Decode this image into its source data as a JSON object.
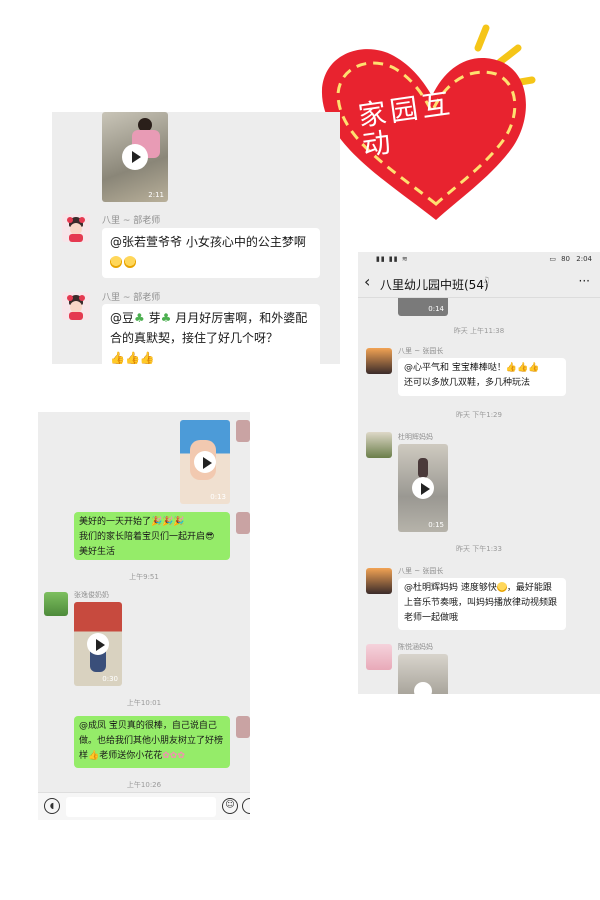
{
  "heart": {
    "title": "家园互动"
  },
  "panel1": {
    "video_duration": "2:11",
    "msg1": {
      "sender": "八里 ~ 部老师",
      "text": "@张若萱爷爷  小女孩心中的公主梦啊"
    },
    "msg2": {
      "sender": "八里 ~ 部老师",
      "text_a": "@豆",
      "text_b": "芽",
      "text_c": "月月好厉害啊，和外婆配合的真默契，接住了好几个呀？"
    }
  },
  "panel2": {
    "video1_duration": "0:13",
    "msg_green1_a": "美好的一天开始了",
    "msg_green1_b": "我们的家长陪着宝贝们一起开启",
    "msg_green1_c": "美好生活",
    "ts1": "上午9:51",
    "sender1": "张逸俊奶奶",
    "video2_duration": "0:30",
    "ts2": "上午10:01",
    "msg_green2_a": "@成凤  宝贝真的很棒，自己说自己做。也给我们其他小朋友树立了好榜样",
    "msg_green2_b": "老师送你小花花",
    "ts3": "上午10:26"
  },
  "panel3": {
    "status_time": "2:04",
    "status_battery": "80",
    "group_title": "八里幼儿园中班(54)",
    "video_top_duration": "0:14",
    "ts1": "昨天 上午11:38",
    "sender1": "八里 ~ 张园长",
    "msg1_a": "@心平气和  宝宝棒棒哒！",
    "msg1_b": "还可以多放几双鞋，多几种玩法",
    "sender2": "杜明辉妈妈",
    "video2_duration": "0:15",
    "ts2": "昨天 下午1:29",
    "ts3": "昨天 下午1:33",
    "sender3": "八里 ~ 张园长",
    "msg3_a": "@杜明辉妈妈  速度够快",
    "msg3_b": "，最好能跟上音乐节奏哦，叫妈妈播放律动视频跟老师一起做哦",
    "sender4": "陈悦涵妈妈"
  },
  "colors": {
    "heart": "#e8232f",
    "dash": "#ffe070",
    "bubble_green": "#95ec69",
    "panel_bg": "#ededed",
    "sun": "#f5c518"
  }
}
